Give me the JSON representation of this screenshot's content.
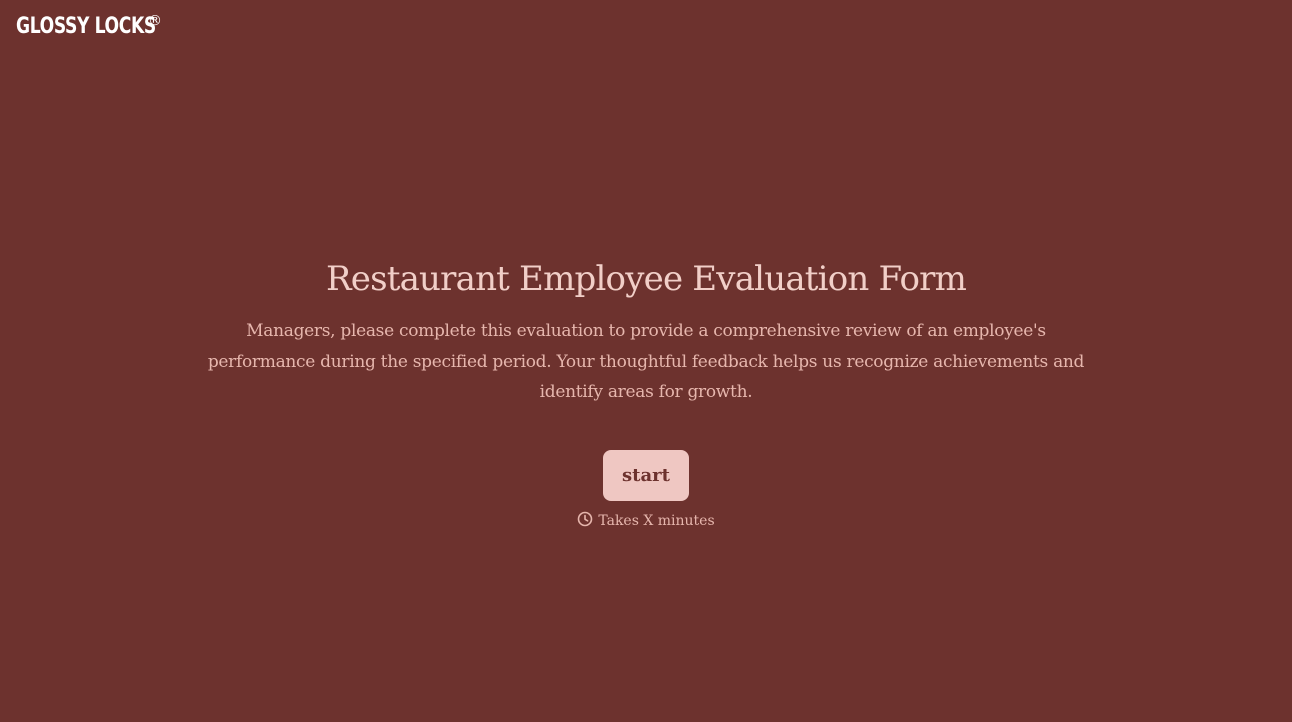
{
  "brand": {
    "name": "GLOSSY LOCKS",
    "registered_mark": "®"
  },
  "form": {
    "title": "Restaurant Employee Evaluation Form",
    "description": "Managers, please complete this evaluation to provide a comprehensive review of an employee's performance during the specified period. Your thoughtful feedback helps us recognize achievements and identify areas for growth.",
    "start_label": "start",
    "time_estimate": "Takes X minutes",
    "time_icon": "clock-icon"
  },
  "colors": {
    "background": "#6d322e",
    "title_text": "#f1cfc8",
    "body_text": "#e6b6ad",
    "button_bg": "#efc7c2",
    "button_text": "#6d322e",
    "logo": "#ffffff"
  }
}
